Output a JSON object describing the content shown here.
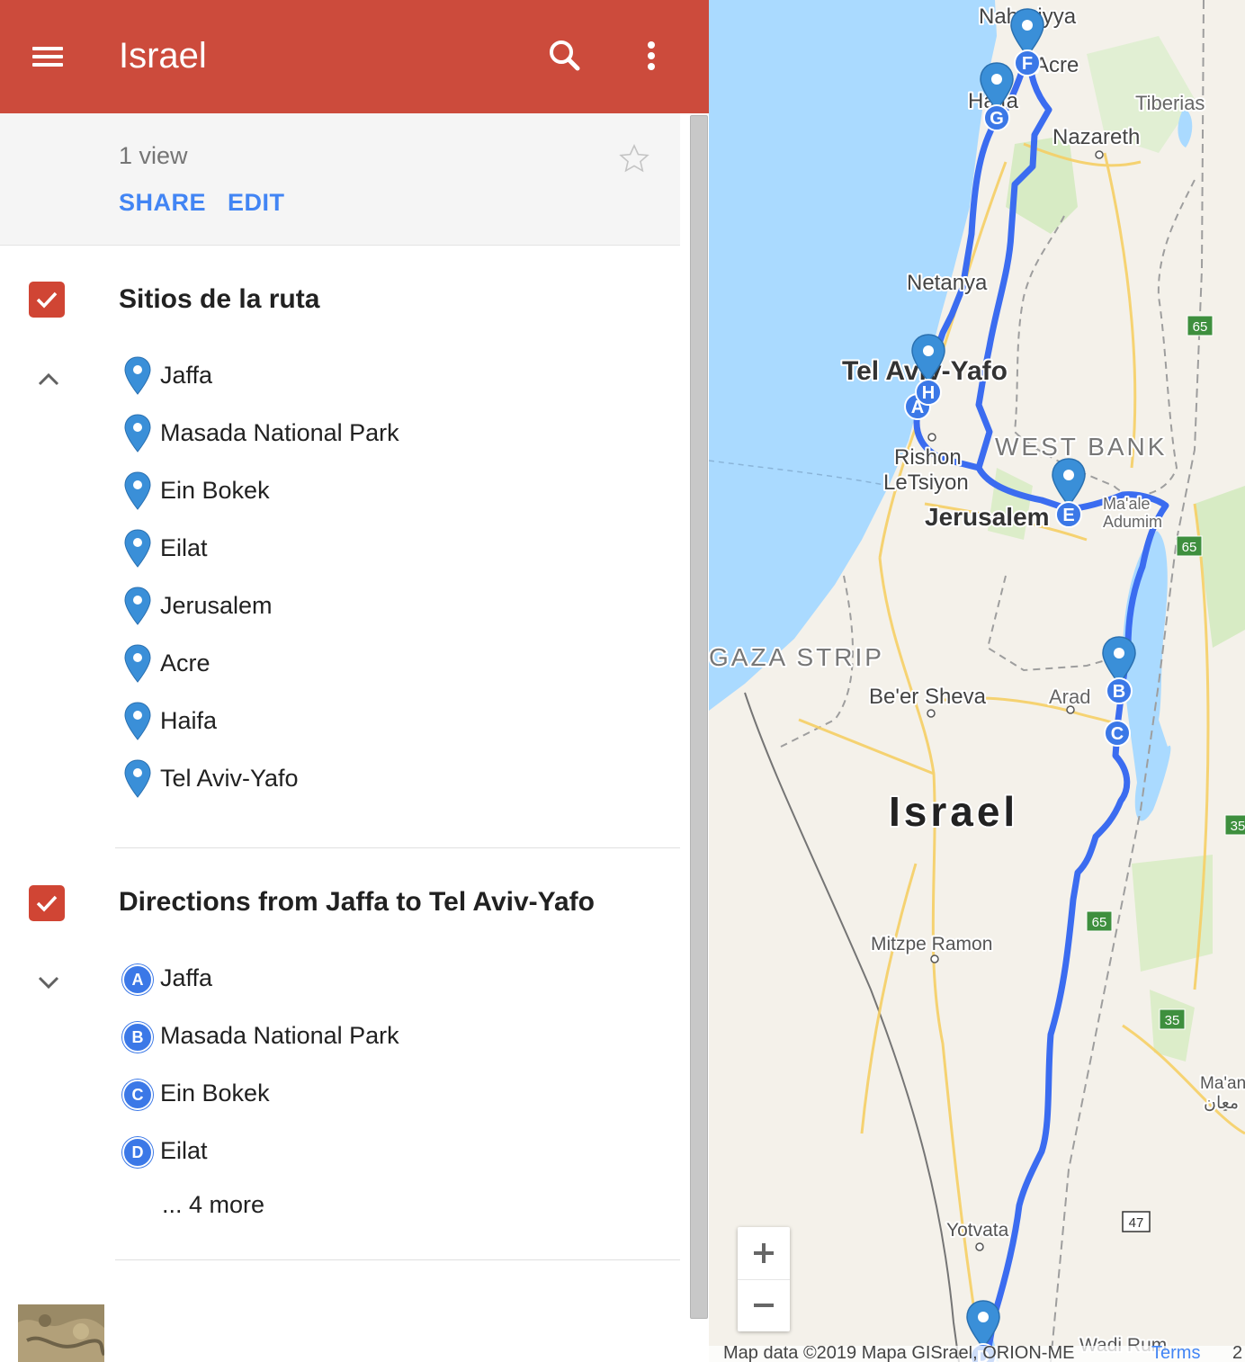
{
  "app": {
    "title": "Israel"
  },
  "icons": {
    "menu": "menu-icon",
    "search": "search-icon",
    "more": "more-vert-icon",
    "star": "star-outline-icon",
    "check": "check-icon",
    "chevron_up": "chevron-up-icon",
    "chevron_down": "chevron-down-icon",
    "place_pin": "place-marker-icon"
  },
  "colors": {
    "header": "#cc4b3c",
    "accent": "#4285f4",
    "checkbox": "#d04534",
    "pin": "#3a8fd8",
    "route": "#3b6cf0"
  },
  "info": {
    "views": "1 view",
    "share": "SHARE",
    "edit": "EDIT"
  },
  "layers": [
    {
      "title": "Sitios de la ruta",
      "checked": true,
      "expanded": true,
      "items": [
        "Jaffa",
        "Masada National Park",
        "Ein Bokek",
        "Eilat",
        "Jerusalem",
        "Acre",
        "Haifa",
        "Tel Aviv-Yafo"
      ]
    },
    {
      "title": "Directions from Jaffa to Tel Aviv-Yafo",
      "checked": true,
      "expanded": false,
      "stops": [
        {
          "letter": "A",
          "label": "Jaffa"
        },
        {
          "letter": "B",
          "label": "Masada National Park"
        },
        {
          "letter": "C",
          "label": "Ein Bokek"
        },
        {
          "letter": "D",
          "label": "Eilat"
        }
      ],
      "more": "... 4 more"
    }
  ],
  "map": {
    "labels": {
      "nahariyya": "Nahariyya",
      "acre": "Acre",
      "haifa": "Haifa",
      "tiberias": "Tiberias",
      "nazareth": "Nazareth",
      "netanya": "Netanya",
      "tel_aviv": "Tel Aviv-Yafo",
      "rishon": "Rishon",
      "letsiyon": "LeTsiyon",
      "west_bank": "WEST BANK",
      "jerusalem": "Jerusalem",
      "maale": "Ma'ale",
      "adumim": "Adumim",
      "gaza": "GAZA STRIP",
      "beer_sheva": "Be'er Sheva",
      "arad": "Arad",
      "israel": "Israel",
      "mitzpe": "Mitzpe Ramon",
      "yotvata": "Yotvata",
      "wadi_rum": "Wadi Rum",
      "maan": "Ma'an",
      "maan_ar": "معان"
    },
    "road_shields": [
      "65",
      "65",
      "65",
      "35",
      "35",
      "47"
    ],
    "markers": [
      "A",
      "B",
      "C",
      "D",
      "E",
      "F",
      "G",
      "H"
    ],
    "zoom_in": "+",
    "zoom_out": "−",
    "attribution": "Map data ©2019 Mapa GISrael, ORION-ME",
    "terms": "Terms",
    "attribution_extra": "2"
  }
}
